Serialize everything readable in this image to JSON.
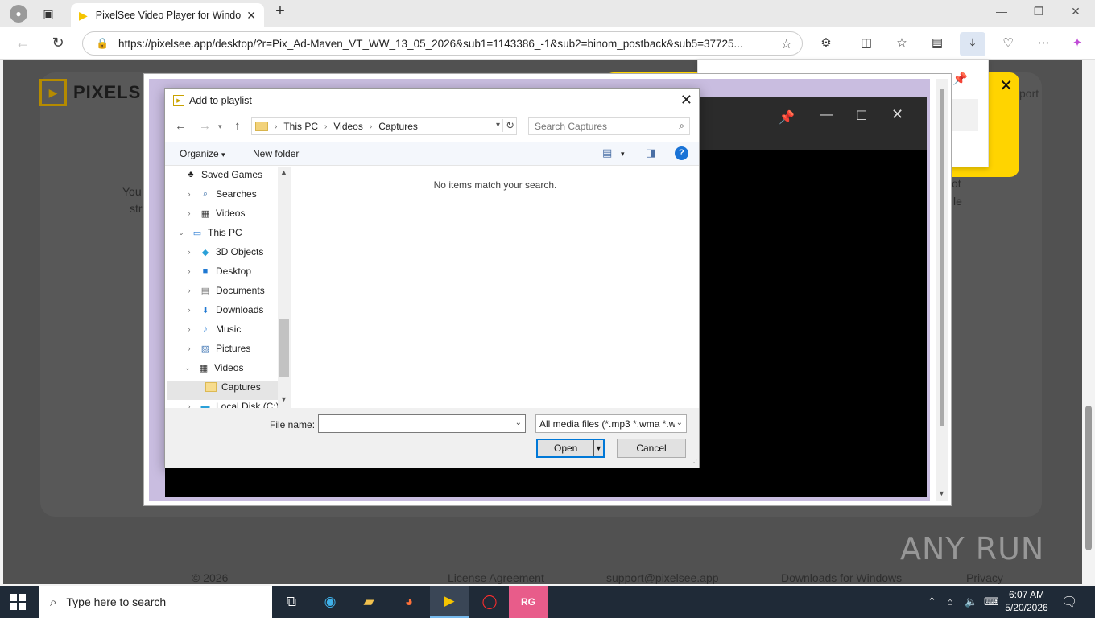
{
  "browser": {
    "tab_title": "PixelSee Video Player for Windows",
    "url": "https://pixelsee.app/desktop/?r=Pix_Ad-Maven_VT_WW_13_05_2026&sub1=1143386_-1&sub2=binom_postback&sub5=37725..."
  },
  "page": {
    "logo_text": "PIXELS",
    "left_text_1": "You",
    "left_text_2": "str",
    "right_text_1": "ot",
    "right_text_2": "le",
    "support_text": "port",
    "footer": {
      "copyright": "© 2026",
      "license": "License Agreement",
      "email": "support@pixelsee.app",
      "downloads": "Downloads for Windows",
      "privacy": "Privacy"
    }
  },
  "dialog": {
    "title": "Add to playlist",
    "breadcrumb": [
      "This PC",
      "Videos",
      "Captures"
    ],
    "search_placeholder": "Search Captures",
    "organize": "Organize",
    "new_folder": "New folder",
    "empty_message": "No items match your search.",
    "tree": [
      {
        "label": "Saved Games",
        "icon": "saved-games-icon"
      },
      {
        "label": "Searches",
        "icon": "search-icon"
      },
      {
        "label": "Videos",
        "icon": "videos-icon"
      },
      {
        "label": "This PC",
        "icon": "pc-icon"
      },
      {
        "label": "3D Objects",
        "icon": "3d-objects-icon"
      },
      {
        "label": "Desktop",
        "icon": "desktop-icon"
      },
      {
        "label": "Documents",
        "icon": "documents-icon"
      },
      {
        "label": "Downloads",
        "icon": "downloads-icon"
      },
      {
        "label": "Music",
        "icon": "music-icon"
      },
      {
        "label": "Pictures",
        "icon": "pictures-icon"
      },
      {
        "label": "Videos",
        "icon": "videos-icon"
      },
      {
        "label": "Captures",
        "icon": "folder-icon"
      },
      {
        "label": "Local Disk (C:)",
        "icon": "disk-icon"
      }
    ],
    "file_name_label": "File name:",
    "file_name_value": "",
    "file_type": "All media files (*.mp3 *.wma *.w",
    "open_label": "Open",
    "cancel_label": "Cancel"
  },
  "taskbar": {
    "search_placeholder": "Type here to search",
    "time": "6:07 AM",
    "date": "5/20/2026"
  },
  "watermark": "ANY RUN"
}
